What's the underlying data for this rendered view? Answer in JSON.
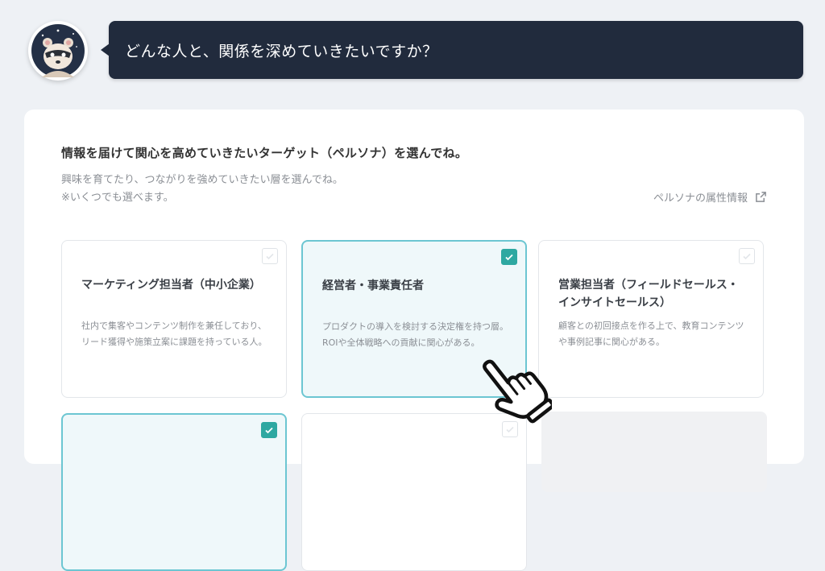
{
  "assistant": {
    "avatar_icon": "ferret-mascot-icon",
    "question": "どんな人と、関係を深めていきたいですか？"
  },
  "panel": {
    "title": "情報を届けて関心を高めていきたいターゲット（ペルソナ）を選んでね。",
    "subtitle_line1": "興味を育てたり、つながりを強めていきたい層を選んでね。",
    "subtitle_line2": "※いくつでも選べます。",
    "persona_link": "ペルソナの属性情報",
    "persona_link_icon": "external-link-icon"
  },
  "cards": [
    {
      "title": "マーケティング担当者（中小企業）",
      "description": "社内で集客やコンテンツ制作を兼任しており、リード獲得や施策立案に課題を持っている人。",
      "selected": false
    },
    {
      "title": "経営者・事業責任者",
      "description": "プロダクトの導入を検討する決定権を持つ層。ROIや全体戦略への貢献に関心がある。",
      "selected": true
    },
    {
      "title": "営業担当者（フィールドセールス・インサイトセールス）",
      "description": "顧客との初回接点を作る上で、教育コンテンツや事例記事に関心がある。",
      "selected": false
    },
    {
      "title": "",
      "description": "",
      "selected": true
    },
    {
      "title": "",
      "description": "",
      "selected": false
    }
  ],
  "cursor_icon": "pointing-hand-cursor-icon",
  "colors": {
    "bubble_bg": "#212b3d",
    "selected_border": "#6cc6d2",
    "selected_bg": "#eff8fa",
    "check_fill": "#2ea8a1"
  }
}
